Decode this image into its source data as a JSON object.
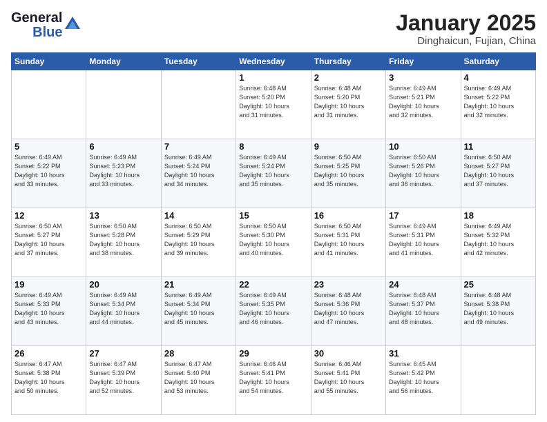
{
  "logo": {
    "name_part1": "General",
    "name_part2": "Blue"
  },
  "header": {
    "title": "January 2025",
    "subtitle": "Dinghaicun, Fujian, China"
  },
  "days_of_week": [
    "Sunday",
    "Monday",
    "Tuesday",
    "Wednesday",
    "Thursday",
    "Friday",
    "Saturday"
  ],
  "weeks": [
    [
      {
        "day": "",
        "info": ""
      },
      {
        "day": "",
        "info": ""
      },
      {
        "day": "",
        "info": ""
      },
      {
        "day": "1",
        "info": "Sunrise: 6:48 AM\nSunset: 5:20 PM\nDaylight: 10 hours\nand 31 minutes."
      },
      {
        "day": "2",
        "info": "Sunrise: 6:48 AM\nSunset: 5:20 PM\nDaylight: 10 hours\nand 31 minutes."
      },
      {
        "day": "3",
        "info": "Sunrise: 6:49 AM\nSunset: 5:21 PM\nDaylight: 10 hours\nand 32 minutes."
      },
      {
        "day": "4",
        "info": "Sunrise: 6:49 AM\nSunset: 5:22 PM\nDaylight: 10 hours\nand 32 minutes."
      }
    ],
    [
      {
        "day": "5",
        "info": "Sunrise: 6:49 AM\nSunset: 5:22 PM\nDaylight: 10 hours\nand 33 minutes."
      },
      {
        "day": "6",
        "info": "Sunrise: 6:49 AM\nSunset: 5:23 PM\nDaylight: 10 hours\nand 33 minutes."
      },
      {
        "day": "7",
        "info": "Sunrise: 6:49 AM\nSunset: 5:24 PM\nDaylight: 10 hours\nand 34 minutes."
      },
      {
        "day": "8",
        "info": "Sunrise: 6:49 AM\nSunset: 5:24 PM\nDaylight: 10 hours\nand 35 minutes."
      },
      {
        "day": "9",
        "info": "Sunrise: 6:50 AM\nSunset: 5:25 PM\nDaylight: 10 hours\nand 35 minutes."
      },
      {
        "day": "10",
        "info": "Sunrise: 6:50 AM\nSunset: 5:26 PM\nDaylight: 10 hours\nand 36 minutes."
      },
      {
        "day": "11",
        "info": "Sunrise: 6:50 AM\nSunset: 5:27 PM\nDaylight: 10 hours\nand 37 minutes."
      }
    ],
    [
      {
        "day": "12",
        "info": "Sunrise: 6:50 AM\nSunset: 5:27 PM\nDaylight: 10 hours\nand 37 minutes."
      },
      {
        "day": "13",
        "info": "Sunrise: 6:50 AM\nSunset: 5:28 PM\nDaylight: 10 hours\nand 38 minutes."
      },
      {
        "day": "14",
        "info": "Sunrise: 6:50 AM\nSunset: 5:29 PM\nDaylight: 10 hours\nand 39 minutes."
      },
      {
        "day": "15",
        "info": "Sunrise: 6:50 AM\nSunset: 5:30 PM\nDaylight: 10 hours\nand 40 minutes."
      },
      {
        "day": "16",
        "info": "Sunrise: 6:50 AM\nSunset: 5:31 PM\nDaylight: 10 hours\nand 41 minutes."
      },
      {
        "day": "17",
        "info": "Sunrise: 6:49 AM\nSunset: 5:31 PM\nDaylight: 10 hours\nand 41 minutes."
      },
      {
        "day": "18",
        "info": "Sunrise: 6:49 AM\nSunset: 5:32 PM\nDaylight: 10 hours\nand 42 minutes."
      }
    ],
    [
      {
        "day": "19",
        "info": "Sunrise: 6:49 AM\nSunset: 5:33 PM\nDaylight: 10 hours\nand 43 minutes."
      },
      {
        "day": "20",
        "info": "Sunrise: 6:49 AM\nSunset: 5:34 PM\nDaylight: 10 hours\nand 44 minutes."
      },
      {
        "day": "21",
        "info": "Sunrise: 6:49 AM\nSunset: 5:34 PM\nDaylight: 10 hours\nand 45 minutes."
      },
      {
        "day": "22",
        "info": "Sunrise: 6:49 AM\nSunset: 5:35 PM\nDaylight: 10 hours\nand 46 minutes."
      },
      {
        "day": "23",
        "info": "Sunrise: 6:48 AM\nSunset: 5:36 PM\nDaylight: 10 hours\nand 47 minutes."
      },
      {
        "day": "24",
        "info": "Sunrise: 6:48 AM\nSunset: 5:37 PM\nDaylight: 10 hours\nand 48 minutes."
      },
      {
        "day": "25",
        "info": "Sunrise: 6:48 AM\nSunset: 5:38 PM\nDaylight: 10 hours\nand 49 minutes."
      }
    ],
    [
      {
        "day": "26",
        "info": "Sunrise: 6:47 AM\nSunset: 5:38 PM\nDaylight: 10 hours\nand 50 minutes."
      },
      {
        "day": "27",
        "info": "Sunrise: 6:47 AM\nSunset: 5:39 PM\nDaylight: 10 hours\nand 52 minutes."
      },
      {
        "day": "28",
        "info": "Sunrise: 6:47 AM\nSunset: 5:40 PM\nDaylight: 10 hours\nand 53 minutes."
      },
      {
        "day": "29",
        "info": "Sunrise: 6:46 AM\nSunset: 5:41 PM\nDaylight: 10 hours\nand 54 minutes."
      },
      {
        "day": "30",
        "info": "Sunrise: 6:46 AM\nSunset: 5:41 PM\nDaylight: 10 hours\nand 55 minutes."
      },
      {
        "day": "31",
        "info": "Sunrise: 6:45 AM\nSunset: 5:42 PM\nDaylight: 10 hours\nand 56 minutes."
      },
      {
        "day": "",
        "info": ""
      }
    ]
  ]
}
